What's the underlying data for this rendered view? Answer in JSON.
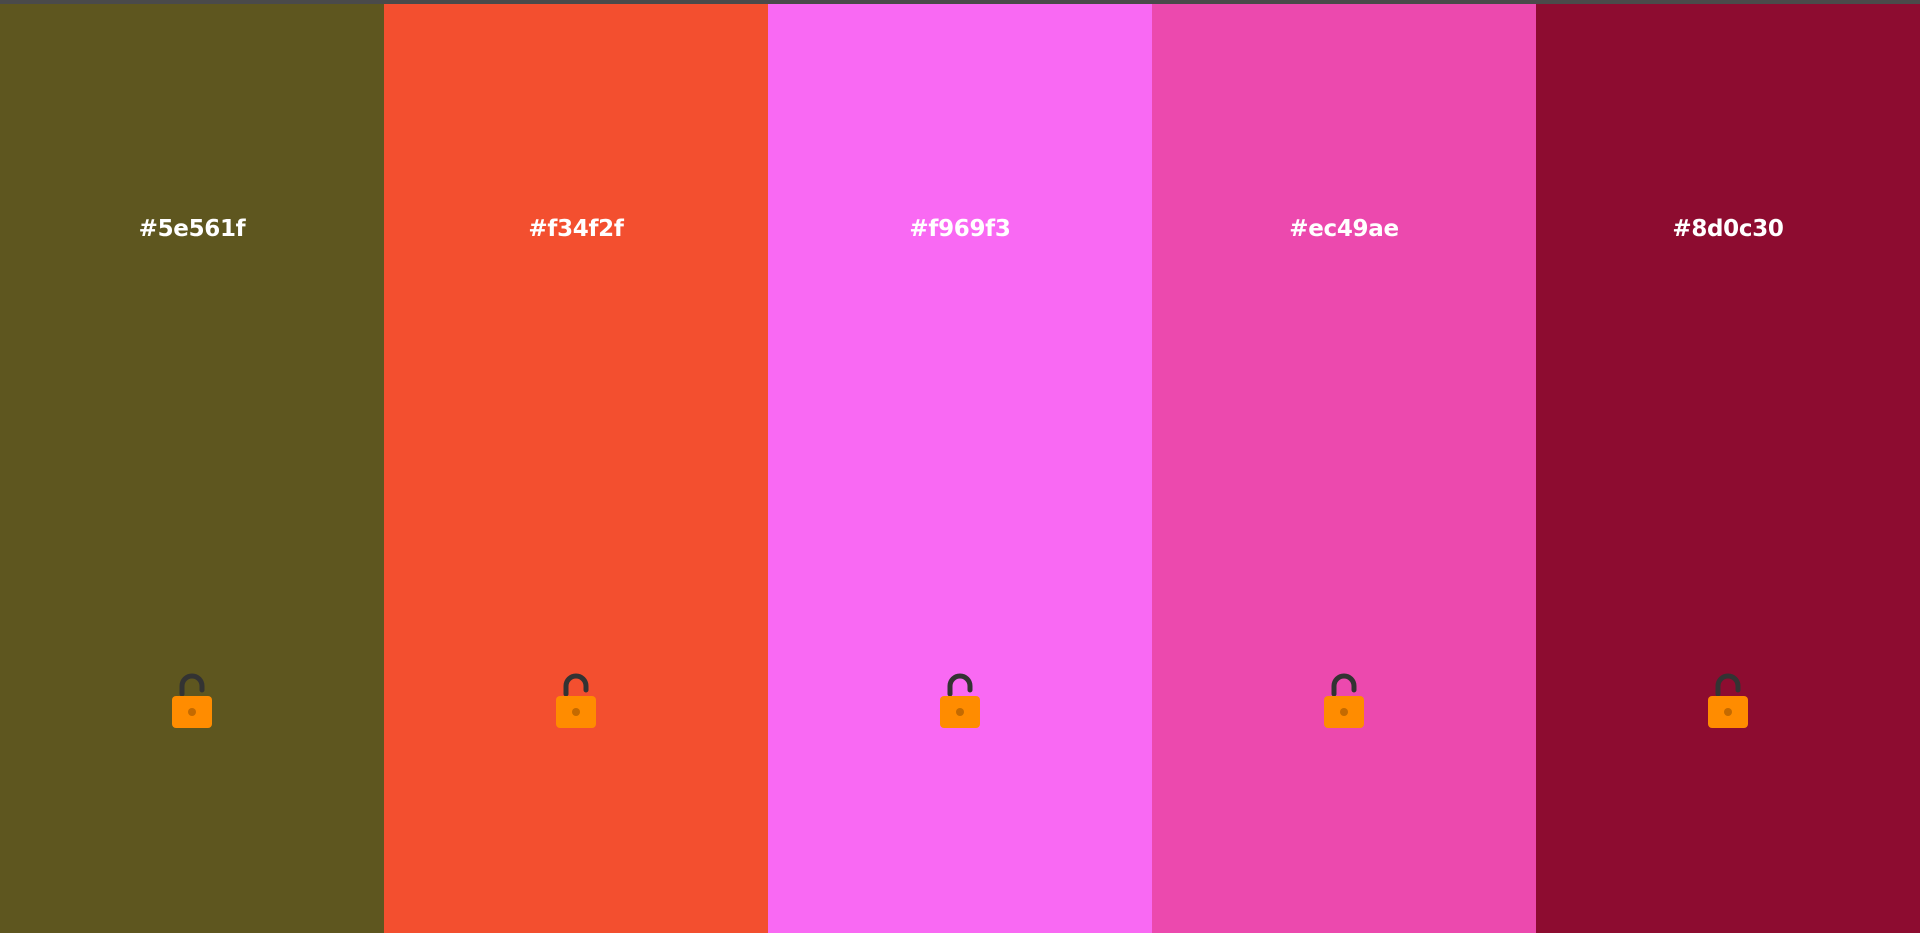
{
  "palette": {
    "lock_icon_colors": {
      "shackle": "#333333",
      "body": "#ff8c00",
      "keyhole": "#c46a00"
    },
    "swatches": [
      {
        "hex": "#5e561f",
        "color": "#5e561f",
        "lock_state": "unlocked",
        "icon": "lock-open-icon"
      },
      {
        "hex": "#f34f2f",
        "color": "#f34f2f",
        "lock_state": "unlocked",
        "icon": "lock-open-icon"
      },
      {
        "hex": "#f969f3",
        "color": "#f969f3",
        "lock_state": "unlocked",
        "icon": "lock-open-icon"
      },
      {
        "hex": "#ec49ae",
        "color": "#ec49ae",
        "lock_state": "unlocked",
        "icon": "lock-open-icon"
      },
      {
        "hex": "#8d0c30",
        "color": "#8d0c30",
        "lock_state": "unlocked",
        "icon": "lock-open-icon"
      }
    ]
  }
}
